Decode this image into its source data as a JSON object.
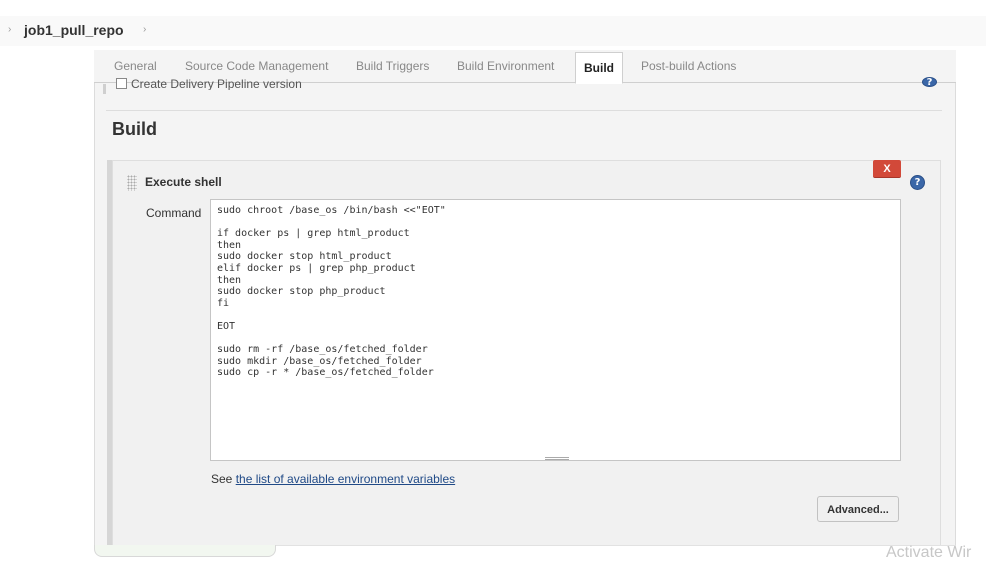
{
  "breadcrumb": {
    "job_name": "job1_pull_repo",
    "separator": "›"
  },
  "tabs": [
    {
      "label": "General",
      "active": false
    },
    {
      "label": "Source Code Management",
      "active": false
    },
    {
      "label": "Build Triggers",
      "active": false
    },
    {
      "label": "Build Environment",
      "active": false
    },
    {
      "label": "Build",
      "active": true
    },
    {
      "label": "Post-build Actions",
      "active": false
    }
  ],
  "general": {
    "pipeline_checkbox_label": "Create Delivery Pipeline version"
  },
  "build": {
    "section_title": "Build",
    "step": {
      "title": "Execute shell",
      "delete_label": "X",
      "command_label": "Command",
      "command_value": "sudo chroot /base_os /bin/bash <<\"EOT\"\n\nif docker ps | grep html_product\nthen\nsudo docker stop html_product\nelif docker ps | grep php_product\nthen\nsudo docker stop php_product\nfi\n\nEOT\n\nsudo rm -rf /base_os/fetched_folder\nsudo mkdir /base_os/fetched_folder\nsudo cp -r * /base_os/fetched_folder",
      "env_prefix": "See ",
      "env_link_text": "the list of available environment variables",
      "advanced_label": "Advanced..."
    }
  },
  "help_glyph": "?",
  "watermark": "Activate Wir",
  "colors": {
    "delete": "#d24939",
    "help": "#3b67a8",
    "link": "#204a87"
  }
}
